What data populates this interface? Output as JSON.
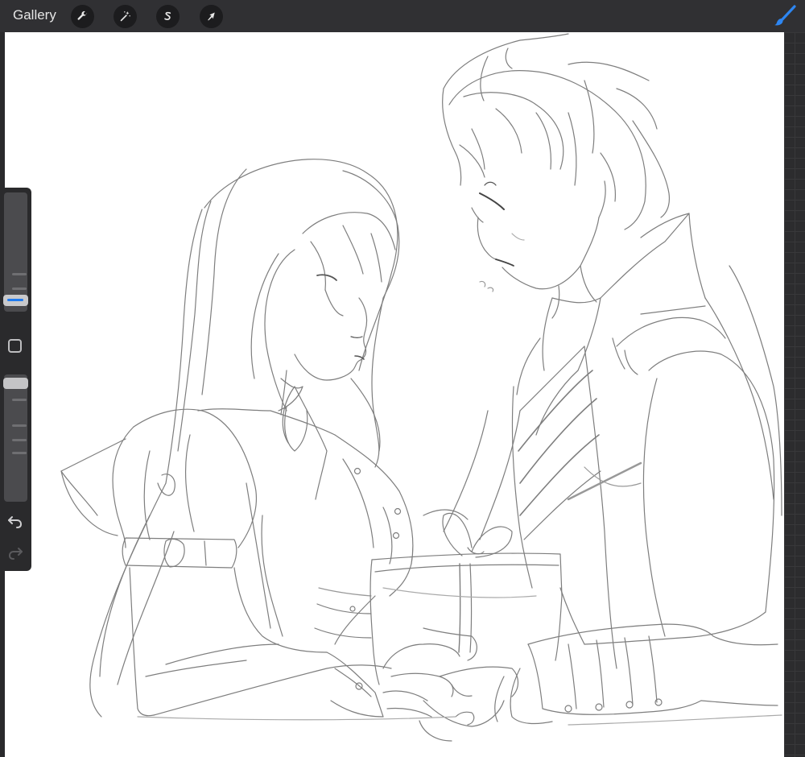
{
  "app": {
    "gallery_label": "Gallery"
  },
  "toolbar": {
    "tools": [
      {
        "name": "actions",
        "icon": "wrench-icon"
      },
      {
        "name": "adjustments",
        "icon": "magic-wand-icon"
      },
      {
        "name": "selection",
        "icon": "selection-s-icon"
      },
      {
        "name": "transform",
        "icon": "arrow-cursor-icon"
      }
    ],
    "brush_icon": "brush-icon"
  },
  "sidebar": {
    "size_slider": "brush-size-slider",
    "modify_button": "modify-button-square-icon",
    "opacity_slider": "opacity-slider",
    "undo_icon": "undo-icon",
    "redo_icon": "redo-icon"
  },
  "colors": {
    "accent": "#1f7bf0",
    "topbar": "#303033",
    "canvas": "#ffffff"
  }
}
